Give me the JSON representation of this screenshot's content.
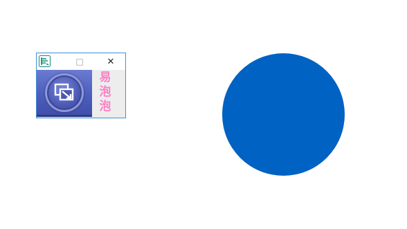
{
  "mini_window": {
    "app_icon": "bubble-app-icon",
    "controls": {
      "maximize": "□",
      "close": "✕"
    },
    "tool_button_icon": "window-restore-icon",
    "label_chars": [
      "易",
      "泡",
      "泡"
    ]
  },
  "circle": {
    "color": "#0062c2"
  }
}
